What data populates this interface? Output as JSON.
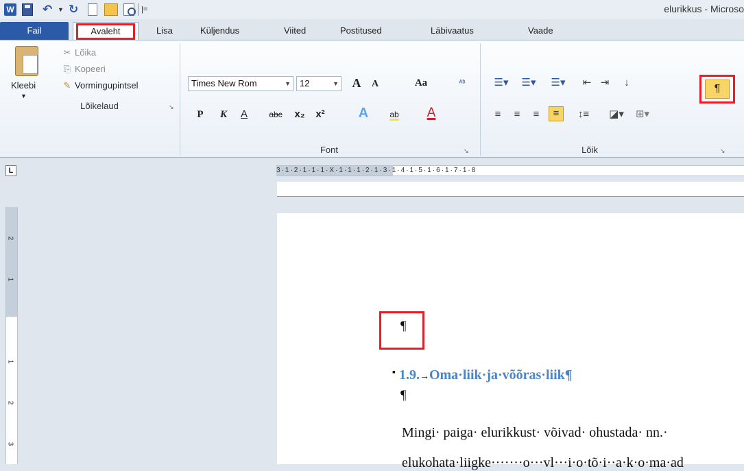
{
  "qat": {
    "word_logo": "W",
    "more": "|=",
    "title": "elurikkus - Microso"
  },
  "tabs": [
    "Fail",
    "Avaleht",
    "Lisa",
    "Küljendus",
    "Viited",
    "Postitused",
    "Läbivaatus",
    "Vaade"
  ],
  "clipboard": {
    "paste": "Kleebi",
    "cut": "Lõika",
    "copy": "Kopeeri",
    "format_painter": "Vormingupintsel",
    "label": "Lõikelaud"
  },
  "font": {
    "family": "Times New Rom",
    "size": "12",
    "grow": "A",
    "shrink": "A",
    "change_case": "Aa",
    "clear": "ᴬᵇ",
    "bold": "P",
    "italic": "K",
    "underline": "A",
    "strike": "abc",
    "sub": "x₂",
    "sup": "x²",
    "effects": "A",
    "highlight": "ab",
    "color": "A",
    "label": "Font"
  },
  "paragraph": {
    "label": "Lõik",
    "show_marks": "¶"
  },
  "ruler": {
    "corner": "L",
    "h_text": "3·1·2·1·1·1·X·1·1·1·2·1·3·1·4·1·5·1·6·1·7·1·8",
    "v_nums": [
      "2",
      "1",
      "1",
      "2",
      "3"
    ]
  },
  "document": {
    "empty_mark": "¶",
    "heading_number": "1.9.",
    "heading_tab": "→",
    "heading_text": "Oma·liik·ja·võõras·liik¶",
    "after_heading_mark": "¶",
    "line1": "Mingi· paiga· elurikkust· võivad· ohustada· nn.·",
    "line2": "elukohata·liigke·······o···vl···i·o·tõ·i··a·k·o·ma·ad"
  }
}
